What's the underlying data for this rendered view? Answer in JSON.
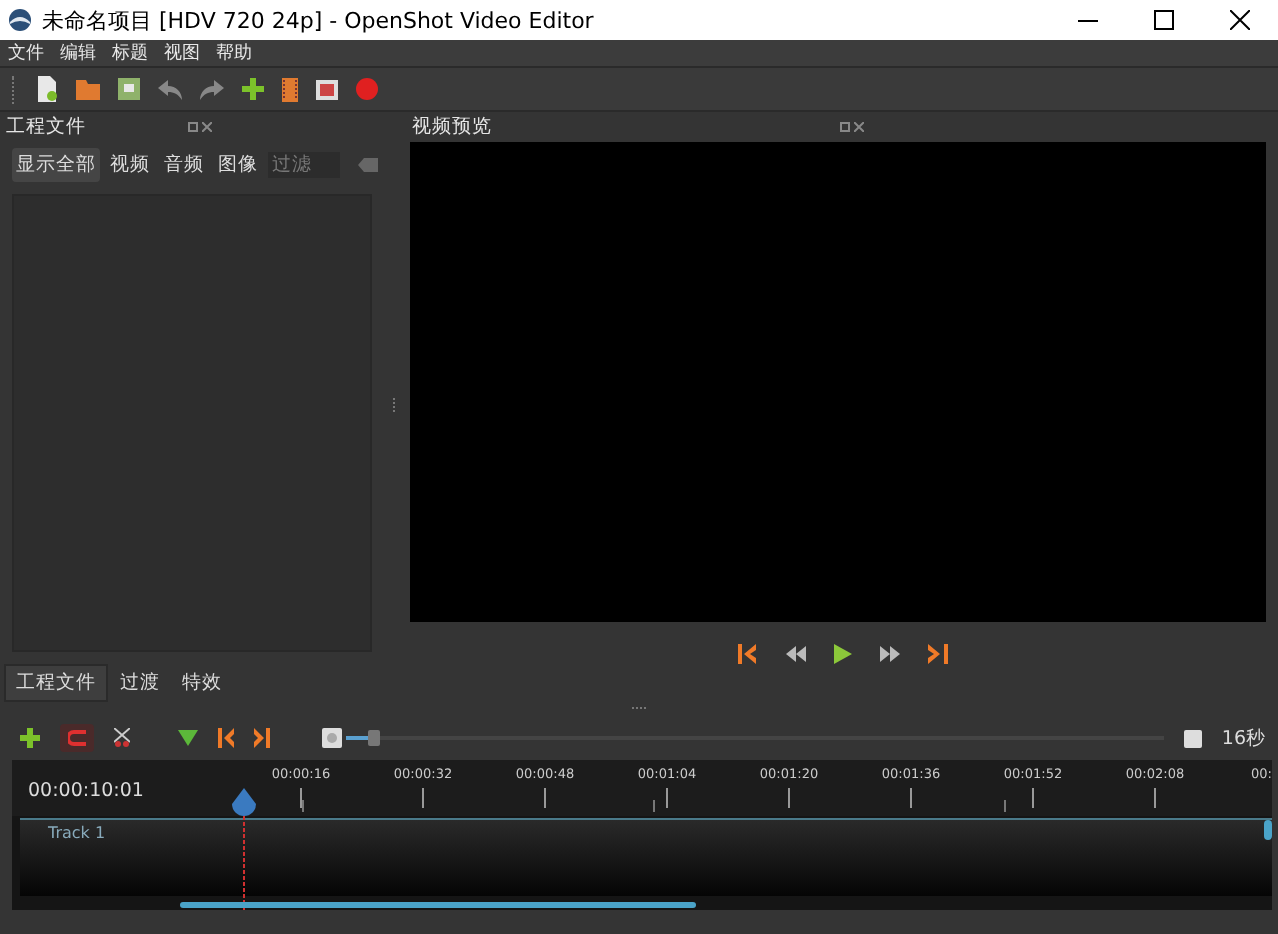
{
  "window": {
    "title": "未命名项目 [HDV 720 24p] - OpenShot Video Editor"
  },
  "menu": [
    "文件",
    "编辑",
    "标题",
    "视图",
    "帮助"
  ],
  "project_files": {
    "title": "工程文件",
    "filters": [
      {
        "label": "显示全部",
        "selected": true
      },
      {
        "label": "视频",
        "selected": false
      },
      {
        "label": "音频",
        "selected": false
      },
      {
        "label": "图像",
        "selected": false
      }
    ],
    "search": {
      "placeholder": "过滤"
    },
    "tabs": [
      {
        "label": "工程文件",
        "selected": true
      },
      {
        "label": "过渡",
        "selected": false
      },
      {
        "label": "特效",
        "selected": false
      }
    ]
  },
  "preview": {
    "title": "视频预览"
  },
  "timeline": {
    "zoom": {
      "level": 0.03,
      "reading": "16秒"
    },
    "current_time": "00:00:10:01",
    "ruler": [
      "00:00:16",
      "00:00:32",
      "00:00:48",
      "00:01:04",
      "00:01:20",
      "00:01:36",
      "00:01:52",
      "00:02:08",
      "00:"
    ],
    "tracks": [
      {
        "name": "Track 1"
      }
    ]
  }
}
